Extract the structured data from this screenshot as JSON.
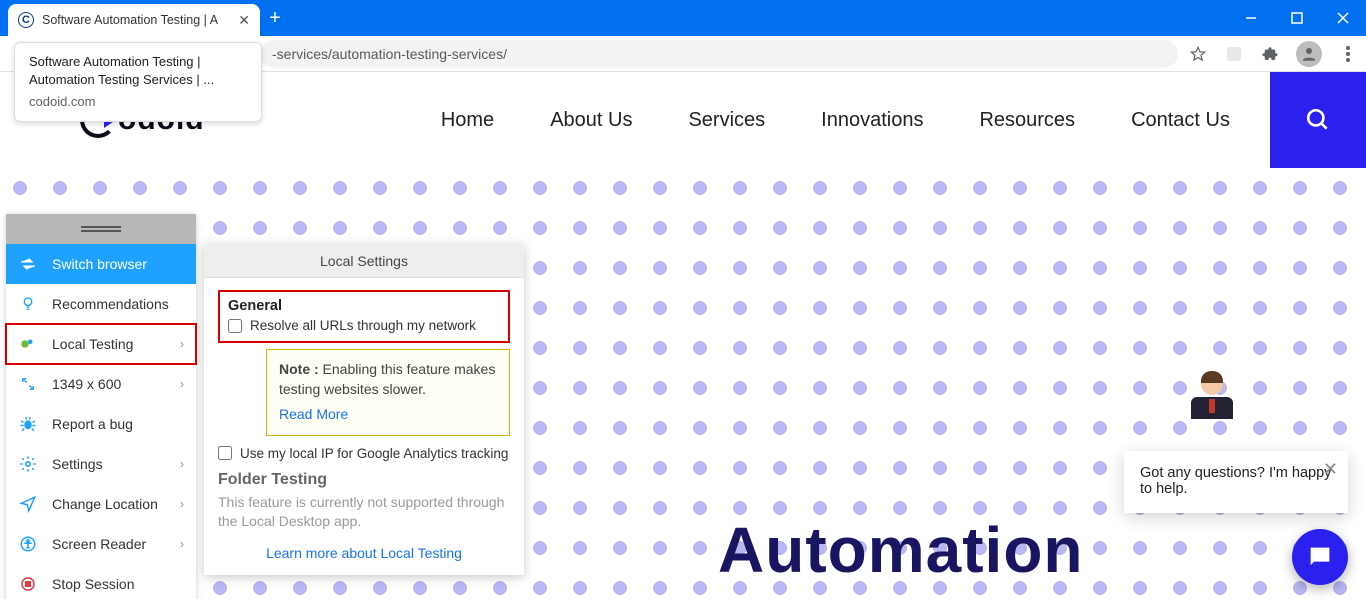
{
  "browser": {
    "tab_title": "Software Automation Testing | A",
    "tooltip_line1": "Software Automation Testing | Automation Testing Services | ...",
    "tooltip_domain": "codoid.com",
    "url_fragment": "-services/automation-testing-services/"
  },
  "site": {
    "logo_text": "odoid",
    "nav": {
      "home": "Home",
      "about": "About Us",
      "services": "Services",
      "innovations": "Innovations",
      "resources": "Resources",
      "contact": "Contact Us"
    },
    "hero_title": "Automation"
  },
  "sidebar": {
    "switch": "Switch browser",
    "recommend": "Recommendations",
    "local": "Local Testing",
    "resolution": "1349 x 600",
    "bug": "Report a bug",
    "settings": "Settings",
    "location": "Change Location",
    "reader": "Screen Reader",
    "stop": "Stop Session"
  },
  "popover": {
    "title": "Local Settings",
    "general": "General",
    "resolve": "Resolve all URLs through my network",
    "note_label": "Note :",
    "note_body": " Enabling this feature makes testing websites slower.",
    "read_more": "Read More",
    "ga": "Use my local IP for Google Analytics tracking",
    "folder_h": "Folder Testing",
    "folder_p": "This feature is currently not supported through the Local Desktop app.",
    "learn": "Learn more about Local Testing"
  },
  "chat": {
    "msg": "Got any questions? I'm happy to help."
  }
}
